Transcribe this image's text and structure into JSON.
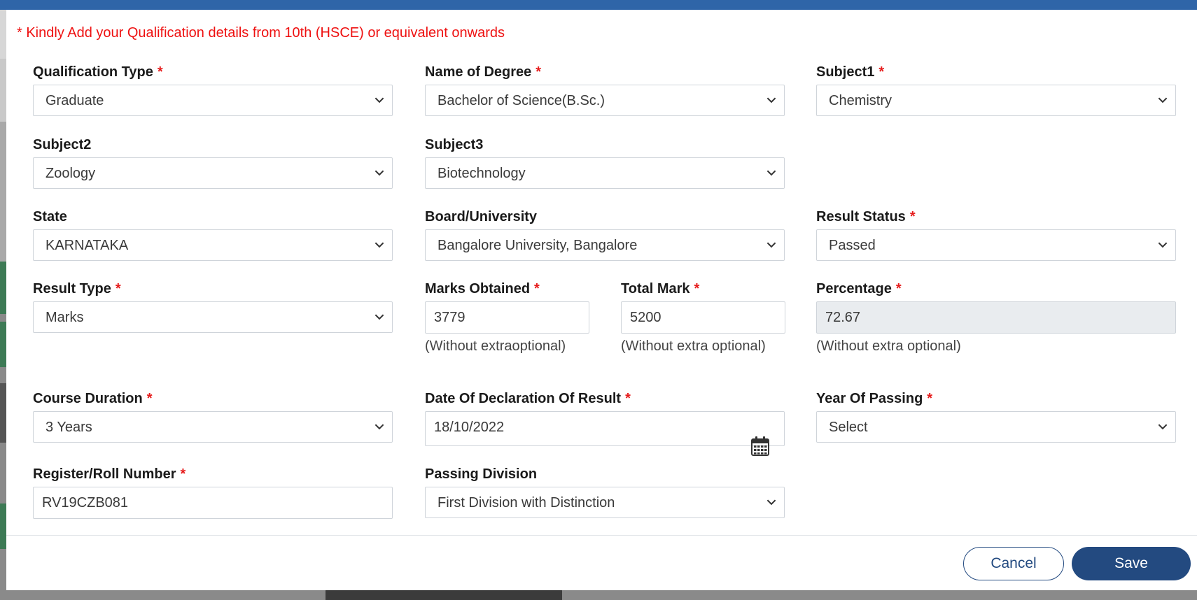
{
  "notice": "* Kindly Add your Qualification details from 10th (HSCE) or equivalent onwards",
  "required_marker": "*",
  "fields": {
    "qualification_type": {
      "label": "Qualification Type",
      "value": "Graduate"
    },
    "name_of_degree": {
      "label": "Name of Degree",
      "value": "Bachelor of Science(B.Sc.)"
    },
    "subject1": {
      "label": "Subject1",
      "value": "Chemistry"
    },
    "subject2": {
      "label": "Subject2",
      "value": "Zoology"
    },
    "subject3": {
      "label": "Subject3",
      "value": "Biotechnology"
    },
    "state": {
      "label": "State",
      "value": "KARNATAKA"
    },
    "board_university": {
      "label": "Board/University",
      "value": "Bangalore University, Bangalore"
    },
    "result_status": {
      "label": "Result Status",
      "value": "Passed"
    },
    "result_type": {
      "label": "Result Type",
      "value": "Marks"
    },
    "marks_obtained": {
      "label": "Marks Obtained",
      "value": "3779",
      "hint": "(Without extraoptional)"
    },
    "total_mark": {
      "label": "Total Mark",
      "value": "5200",
      "hint": "(Without extra optional)"
    },
    "percentage": {
      "label": "Percentage",
      "value": "72.67",
      "hint": "(Without extra optional)"
    },
    "course_duration": {
      "label": "Course Duration",
      "value": "3 Years"
    },
    "date_of_declaration": {
      "label": "Date Of Declaration Of Result",
      "value": "18/10/2022"
    },
    "year_of_passing": {
      "label": "Year Of Passing",
      "value": "Select"
    },
    "register_roll_number": {
      "label": "Register/Roll Number",
      "value": "RV19CZB081"
    },
    "passing_division": {
      "label": "Passing Division",
      "value": "First Division with Distinction"
    }
  },
  "buttons": {
    "cancel": "Cancel",
    "save": "Save"
  },
  "icons": {
    "dropdown": "chevron-down-icon",
    "date": "calendar-icon"
  },
  "colors": {
    "header_bar": "#2f65a8",
    "primary": "#234a80",
    "required": "#e61c1c",
    "notice": "#ee1111"
  }
}
